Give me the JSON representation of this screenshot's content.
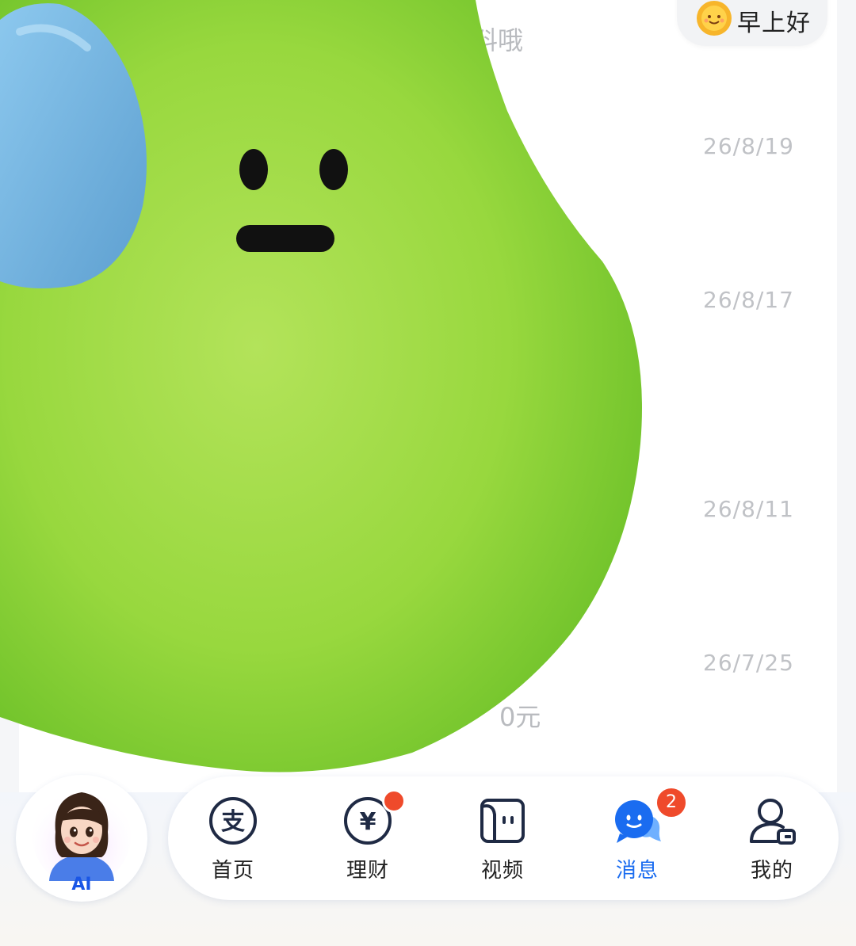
{
  "header": {
    "greeting": "早上好",
    "partial_snippet_top": "料哦"
  },
  "messages": [
    {
      "time": "26/8/19"
    },
    {
      "time": "26/8/17"
    },
    {
      "time": "26/8/11"
    },
    {
      "time": "26/7/25",
      "partial_snippet": "0元"
    }
  ],
  "ai_assistant": {
    "label": "AI"
  },
  "tabbar": {
    "items": [
      {
        "label": "首页",
        "icon": "alipay-icon"
      },
      {
        "label": "理财",
        "icon": "yuan-icon",
        "dot": true
      },
      {
        "label": "视频",
        "icon": "video-icon"
      },
      {
        "label": "消息",
        "icon": "message-icon",
        "badge": "2",
        "active": true
      },
      {
        "label": "我的",
        "icon": "profile-icon"
      }
    ]
  },
  "colors": {
    "active": "#1a6cf0",
    "badge": "#ef4a2b",
    "sticker_green": "#8fd33a"
  }
}
